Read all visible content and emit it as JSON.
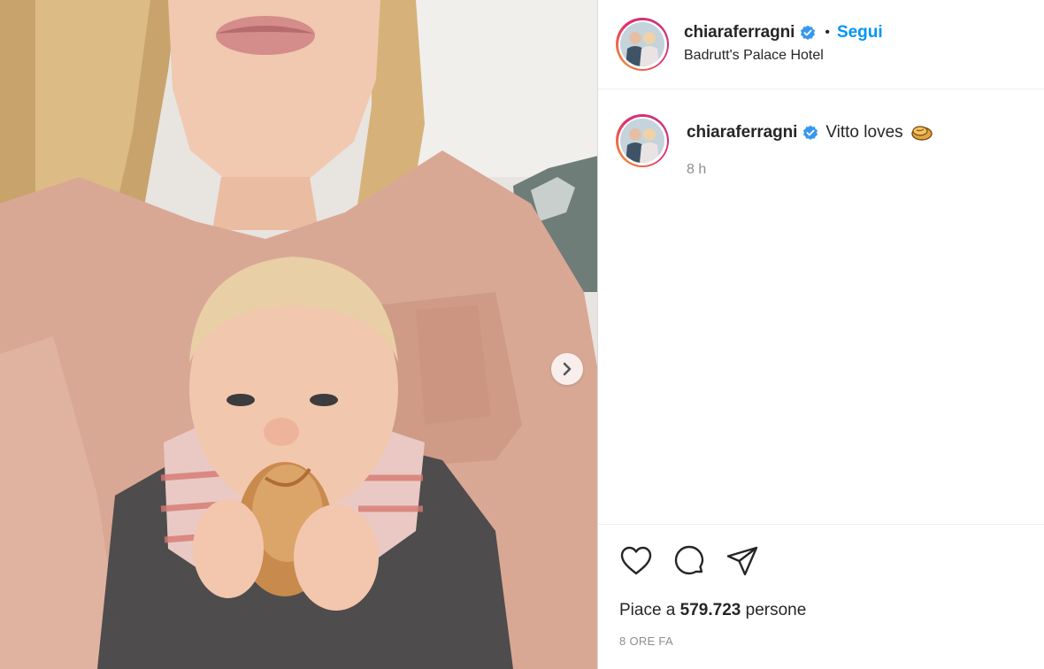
{
  "post": {
    "media": {
      "next_button_icon": "chevron-right-icon"
    },
    "header": {
      "username": "chiaraferragni",
      "verified_icon": "verified-badge-icon",
      "separator": "•",
      "follow_label": "Segui",
      "location": "Badrutt's Palace Hotel"
    },
    "caption": {
      "username": "chiaraferragni",
      "text": "Vitto loves",
      "emoji_icon": "bread-emoji-icon",
      "time": "8 h"
    },
    "actions": {
      "like_icon": "heart-icon",
      "comment_icon": "comment-icon",
      "share_icon": "paper-plane-icon"
    },
    "likes": {
      "prefix": "Piace a ",
      "count": "579.723",
      "suffix": " persone"
    },
    "posted_time": "8 ORE FA"
  },
  "colors": {
    "accent": "#0095f6",
    "verified": "#3897f0",
    "muted": "#8e8e8e",
    "text": "#262626"
  }
}
